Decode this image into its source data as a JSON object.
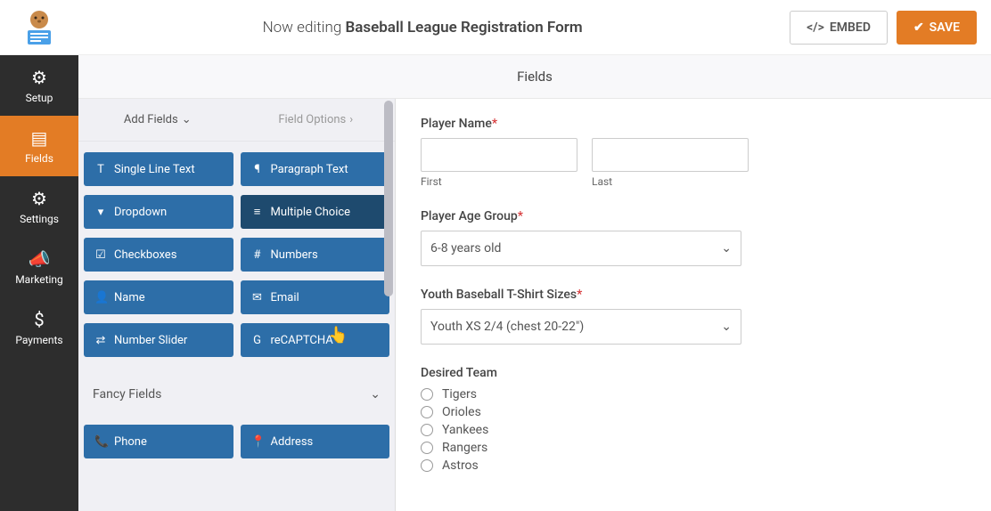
{
  "header": {
    "prefix": "Now editing",
    "title": "Baseball League Registration Form",
    "embed": "EMBED",
    "save": "SAVE"
  },
  "sidebar": {
    "items": [
      {
        "label": "Setup"
      },
      {
        "label": "Fields"
      },
      {
        "label": "Settings"
      },
      {
        "label": "Marketing"
      },
      {
        "label": "Payments"
      }
    ]
  },
  "tabs": {
    "main": "Fields"
  },
  "panel": {
    "add_fields": "Add Fields",
    "field_options": "Field Options",
    "fancy_section": "Fancy Fields",
    "standard": [
      {
        "icon": "T",
        "label": "Single Line Text"
      },
      {
        "icon": "¶",
        "label": "Paragraph Text"
      },
      {
        "icon": "▾",
        "label": "Dropdown"
      },
      {
        "icon": "≡",
        "label": "Multiple Choice"
      },
      {
        "icon": "☑",
        "label": "Checkboxes"
      },
      {
        "icon": "#",
        "label": "Numbers"
      },
      {
        "icon": "👤",
        "label": "Name"
      },
      {
        "icon": "✉",
        "label": "Email"
      },
      {
        "icon": "⇄",
        "label": "Number Slider"
      },
      {
        "icon": "G",
        "label": "reCAPTCHA"
      }
    ],
    "fancy": [
      {
        "icon": "📞",
        "label": "Phone"
      },
      {
        "icon": "📍",
        "label": "Address"
      }
    ]
  },
  "form": {
    "player_name": {
      "label": "Player Name",
      "first": "First",
      "last": "Last"
    },
    "age_group": {
      "label": "Player Age Group",
      "value": "6-8 years old"
    },
    "tshirt": {
      "label": "Youth Baseball T-Shirt Sizes",
      "value": "Youth XS  2/4 (chest 20-22\")"
    },
    "team": {
      "label": "Desired Team",
      "options": [
        "Tigers",
        "Orioles",
        "Yankees",
        "Rangers",
        "Astros"
      ]
    }
  }
}
